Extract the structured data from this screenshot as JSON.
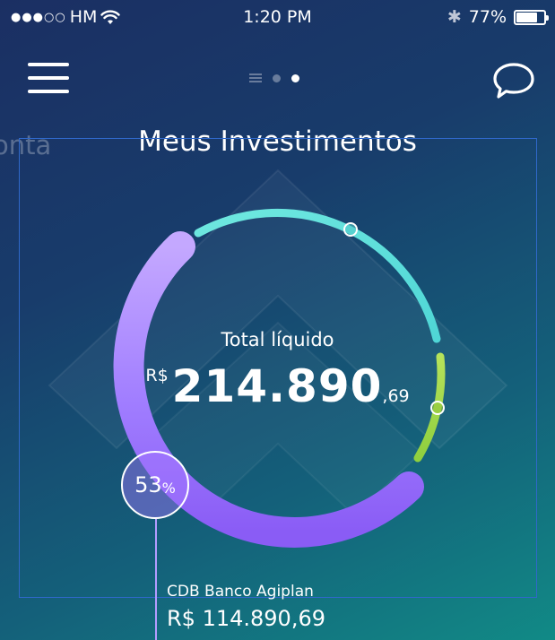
{
  "status_bar": {
    "signal": "●●●○○",
    "carrier": "HM",
    "time": "1:20 PM",
    "bluetooth": "✱",
    "battery_percent": "77%",
    "battery_level": 0.77
  },
  "header": {
    "menu_icon": "hamburger-menu-icon",
    "chat_icon": "speech-bubble-icon",
    "page_indicator": {
      "pages": 3,
      "current": 3
    }
  },
  "side_label": "onta",
  "title": "Meus Investimentos",
  "summary": {
    "label": "Total líquido",
    "currency": "R$",
    "amount": "214.890",
    "cents": ",69"
  },
  "selected": {
    "percent_number": "53",
    "percent_sign": "%",
    "name": "CDB Banco Agiplan",
    "value": "R$ 114.890,69"
  },
  "colors": {
    "primary_segment": "#a07dff",
    "secondary_segment": "#5de6e0",
    "tertiary_segment": "#a6d94c",
    "focus_frame": "#2f68c9"
  }
}
